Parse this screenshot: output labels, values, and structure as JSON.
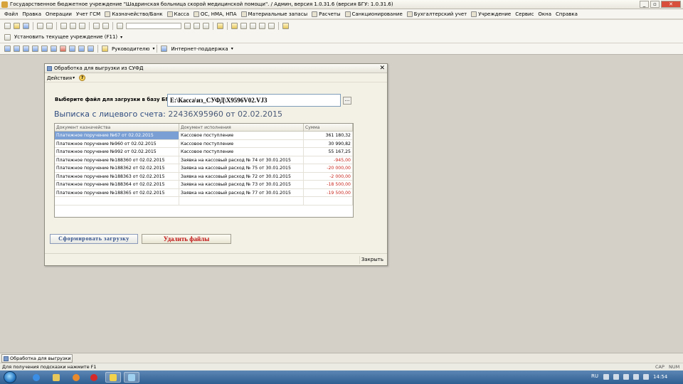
{
  "window": {
    "title": "Государственное бюджетное учреждение \"Шадринская больница скорой медицинской помощи\". / Админ, версия 1.0.31.6 (версия БГУ: 1.0.31.6)",
    "min": "_",
    "max": "▫",
    "close": "✕"
  },
  "menu": [
    "Файл",
    "Правка",
    "Операции",
    "Учет ГСМ",
    "Казначейство/Банк",
    "Касса",
    "ОС, НМА, НПА",
    "Материальные запасы",
    "Расчеты",
    "Санкционирование",
    "Бухгалтерский учет",
    "Учреждение",
    "Сервис",
    "Окна",
    "Справка"
  ],
  "toolbar2": {
    "set_institution": "Установить текущее учреждение (F11)"
  },
  "toolbar3": {
    "manager": "Руководителю",
    "support": "Интернет-поддержка"
  },
  "dialog": {
    "title": "Обработка для выгрузки из СУФД",
    "actions": "Действия",
    "help": "?",
    "close_x": "✕",
    "file_label": "Выберите файл для загрузки в базу БГУ:",
    "file_value": "E:\\Касса\\из_СУФД\\X9596V02.VJ3",
    "file_button": "...",
    "statement_prefix": "Выписка с лицевого счета:",
    "account": "22436X95960",
    "from_word": "от",
    "date": "02.02.2015",
    "grid": {
      "headers": [
        "Документ казначейства",
        "Документ исполнения",
        "Сумма"
      ],
      "rows": [
        {
          "doc": "Платежное поручение №67 от 02.02.2015",
          "exec": "Кассовое поступление",
          "sum": "361 180,32",
          "neg": false
        },
        {
          "doc": "Платежное поручение №960 от 02.02.2015",
          "exec": "Кассовое поступление",
          "sum": "30 990,82",
          "neg": false
        },
        {
          "doc": "Платежное поручение №992 от 02.02.2015",
          "exec": "Кассовое поступление",
          "sum": "55 167,25",
          "neg": false
        },
        {
          "doc": "Платежное поручение №188360 от 02.02.2015",
          "exec": "Заявка на кассовый расход № 74 от 30.01.2015",
          "sum": "-945,00",
          "neg": true
        },
        {
          "doc": "Платежное поручение №188362 от 02.02.2015",
          "exec": "Заявка на кассовый расход № 75 от 30.01.2015",
          "sum": "-20 000,00",
          "neg": true
        },
        {
          "doc": "Платежное поручение №188363 от 02.02.2015",
          "exec": "Заявка на кассовый расход № 72 от 30.01.2015",
          "sum": "-2 000,00",
          "neg": true
        },
        {
          "doc": "Платежное поручение №188364 от 02.02.2015",
          "exec": "Заявка на кассовый расход № 73 от 30.01.2015",
          "sum": "-18 500,00",
          "neg": true
        },
        {
          "doc": "Платежное поручение №188365 от 02.02.2015",
          "exec": "Заявка на кассовый расход № 77 от 30.01.2015",
          "sum": "-19 500,00",
          "neg": true
        }
      ]
    },
    "btn_form": "Сформировать загрузку",
    "btn_delete": "Удалить файлы",
    "btn_close": "Закрыть"
  },
  "window_tab": "Обработка для выгрузки и...",
  "status": {
    "hint": "Для получения подсказки нажмите F1",
    "cap": "CAP",
    "num": "NUM"
  },
  "taskbar": {
    "lang": "RU",
    "time": "14:54"
  }
}
